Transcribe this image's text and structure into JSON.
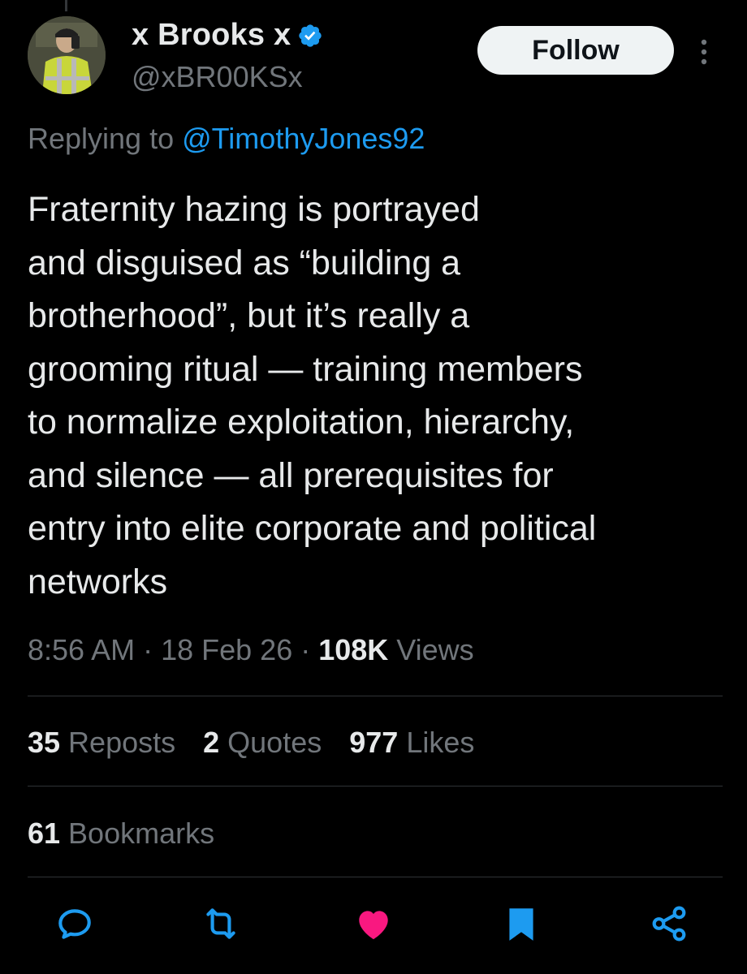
{
  "user": {
    "display_name": "x Brooks x",
    "handle": "@xBR00KSx",
    "verified_icon": "verified-badge-icon",
    "avatar_icon": "avatar"
  },
  "follow_button": {
    "label": "Follow"
  },
  "more_icon": "more-vertical-icon",
  "reply": {
    "prefix": "Replying to ",
    "mention": "@TimothyJones92"
  },
  "tweet": {
    "text": "Fraternity hazing is portrayed\nand disguised as “building a\nbrotherhood”, but it’s really a\ngrooming ritual — training members\nto normalize exploitation, hierarchy,\nand silence — all prerequisites for\nentry into elite corporate and political\nnetworks"
  },
  "meta": {
    "time": "8:56 AM",
    "sep1": " · ",
    "date": "18 Feb 26",
    "sep2": " · ",
    "views_count": "108K",
    "views_label": " Views"
  },
  "stats": {
    "reposts_count": "35",
    "reposts_label": " Reposts",
    "quotes_count": "2",
    "quotes_label": " Quotes",
    "likes_count": "977",
    "likes_label": " Likes",
    "bookmarks_count": "61",
    "bookmarks_label": " Bookmarks"
  },
  "actions": [
    "reply-icon",
    "repost-icon",
    "like-icon",
    "bookmark-icon",
    "share-icon"
  ],
  "colors": {
    "background": "#000000",
    "text": "#e7e9ea",
    "secondary": "#71767b",
    "accent": "#1d9bf0",
    "like": "#f91880",
    "divider": "#2f3336"
  }
}
